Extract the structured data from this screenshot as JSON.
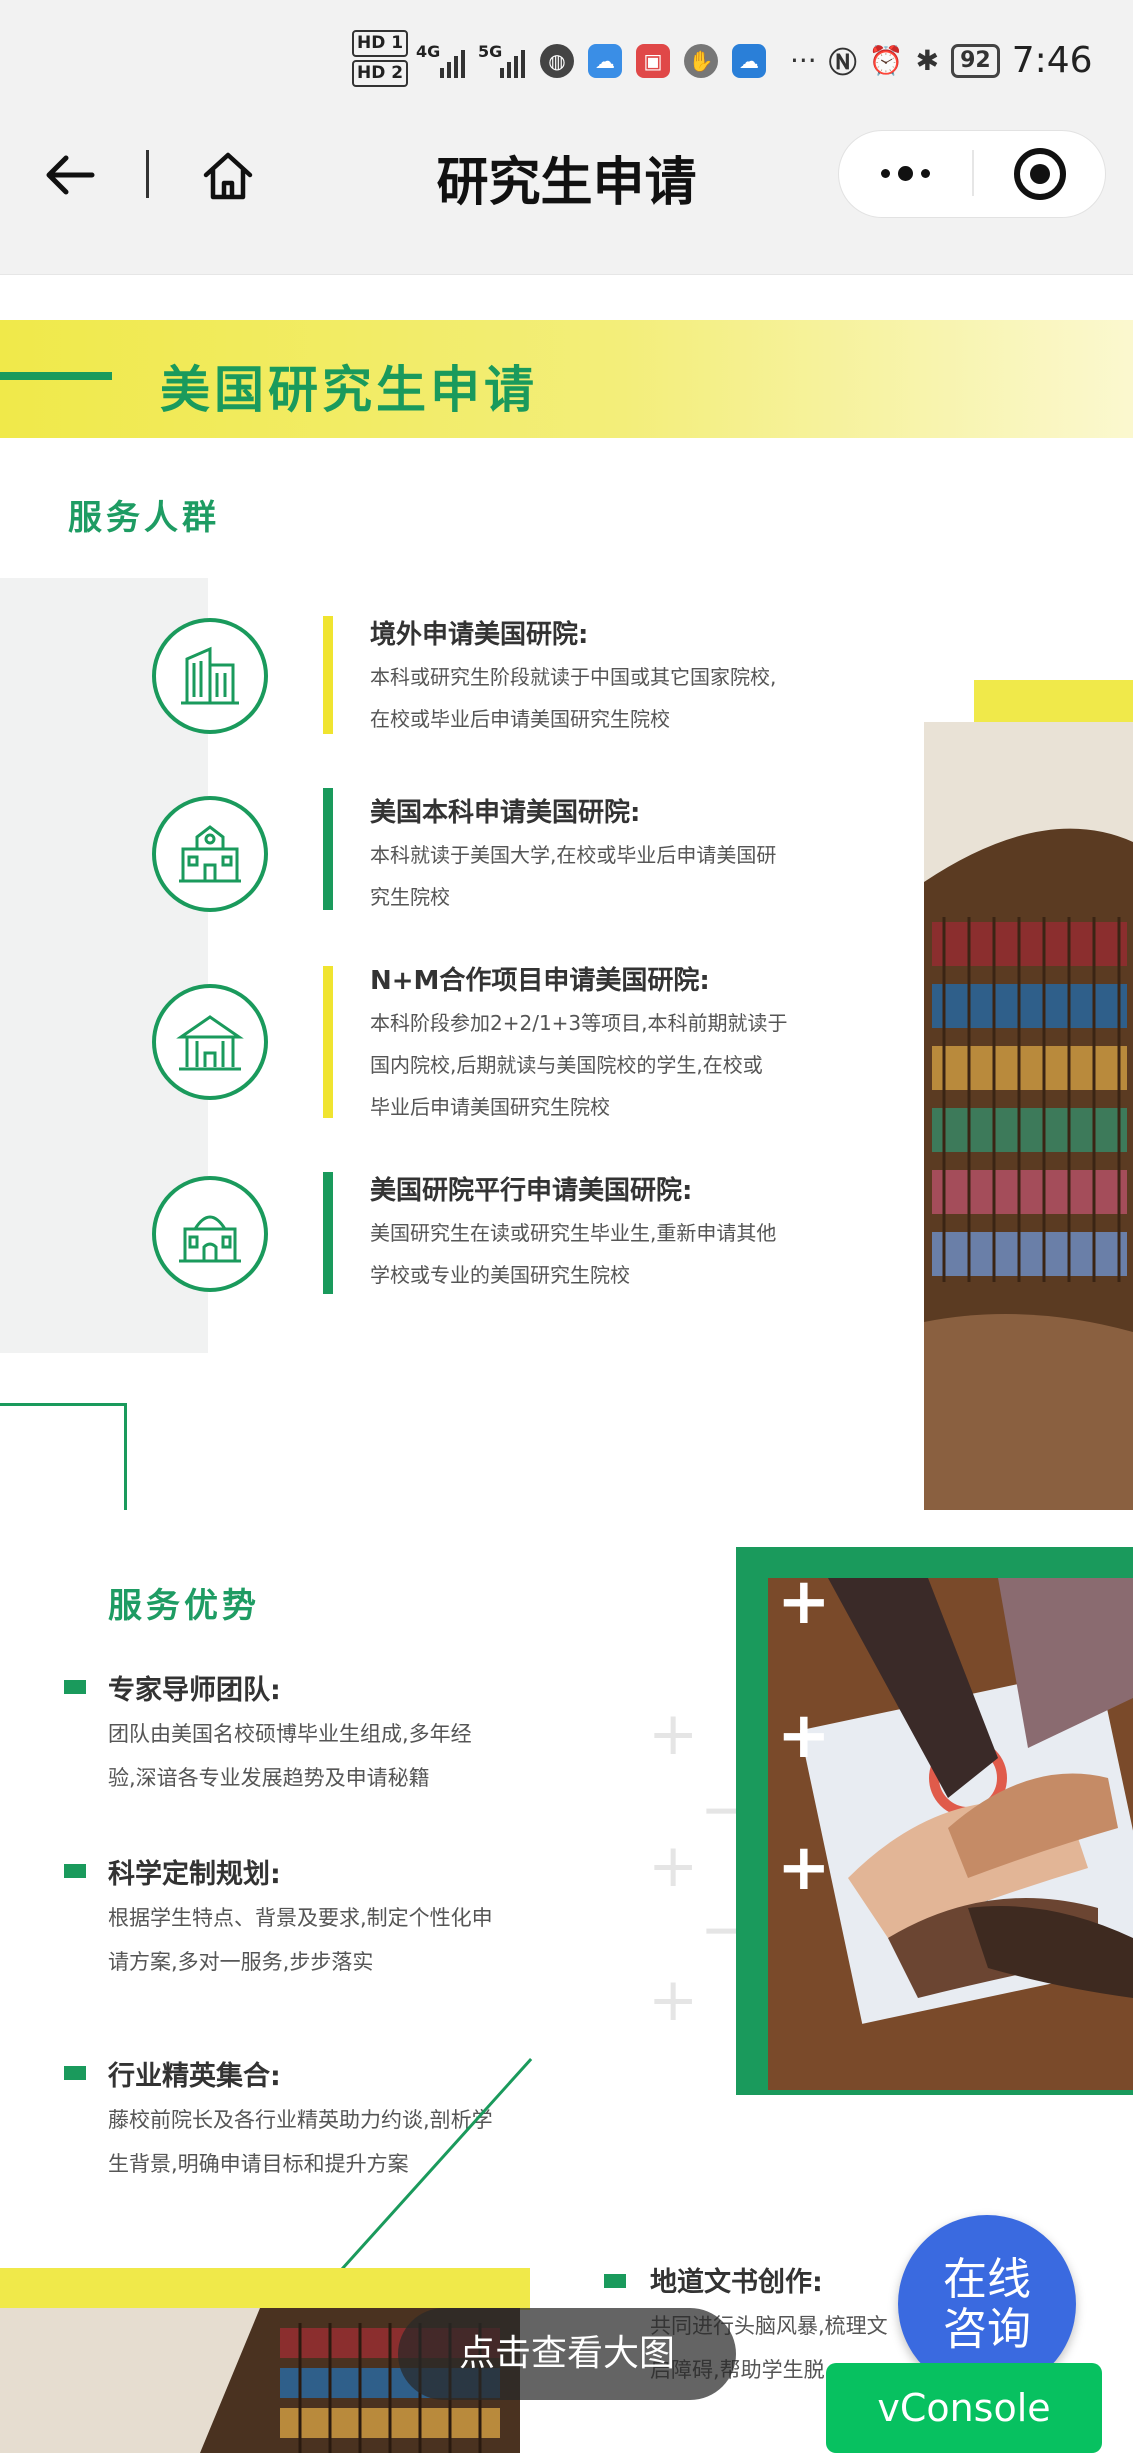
{
  "status_bar": {
    "hd1": "HD 1",
    "hd2": "HD 2",
    "sig1": "4G",
    "sig2": "5G",
    "more": "···",
    "battery": "92",
    "time": "7:46"
  },
  "nav": {
    "title": "研究生申请"
  },
  "banner": {
    "title": "美国研究生申请"
  },
  "service_people": {
    "title": "服务人群",
    "items": [
      {
        "title": "境外申请美国研院:",
        "desc_line1": "本科或研究生阶段就读于中国或其它国家院校,",
        "desc_line2": "在校或毕业后申请美国研究生院校",
        "icon": "office-building-icon",
        "bar_color": "#f0e430"
      },
      {
        "title": "美国本科申请美国研院:",
        "desc_line1": "本科就读于美国大学,在校或毕业后申请美国研",
        "desc_line2": "究生院校",
        "icon": "school-building-icon",
        "bar_color": "#1a9a5c"
      },
      {
        "title": "N+M合作项目申请美国研院:",
        "desc_line1": "本科阶段参加2+2/1+3等项目,本科前期就读于",
        "desc_line2": "国内院校,后期就读与美国院校的学生,在校或",
        "desc_line3": "毕业后申请美国研究生院校",
        "icon": "pavilion-icon",
        "bar_color": "#f0e430"
      },
      {
        "title": "美国研院平行申请美国研院:",
        "desc_line1": "美国研究生在读或研究生毕业生,重新申请其他",
        "desc_line2": "学校或专业的美国研究生院校",
        "icon": "domed-hall-icon",
        "bar_color": "#1a9a5c"
      }
    ]
  },
  "advantages": {
    "title": "服务优势",
    "items": [
      {
        "title": "专家导师团队:",
        "desc_line1": "团队由美国名校硕博毕业生组成,多年经",
        "desc_line2": "验,深谙各专业发展趋势及申请秘籍"
      },
      {
        "title": "科学定制规划:",
        "desc_line1": "根据学生特点、背景及要求,制定个性化申",
        "desc_line2": "请方案,多对一服务,步步落实"
      },
      {
        "title": "行业精英集合:",
        "desc_line1": "藤校前院长及各行业精英助力约谈,剖析学",
        "desc_line2": "生背景,明确申请目标和提升方案"
      }
    ]
  },
  "bottom_item": {
    "title": "地道文书创作:",
    "desc_line1": "共同进行头脑风暴,梳理文",
    "desc_line2": "启障碍,帮助学生脱"
  },
  "toast": {
    "label": "点击查看大图"
  },
  "consult": {
    "line1": "在线",
    "line2": "咨询"
  },
  "vconsole": {
    "label": "vConsole"
  },
  "colors": {
    "brand_green": "#1a9a5c",
    "brand_yellow": "#f0e94a",
    "consult_blue": "#3a6ae0",
    "vconsole_green": "#07c160"
  }
}
